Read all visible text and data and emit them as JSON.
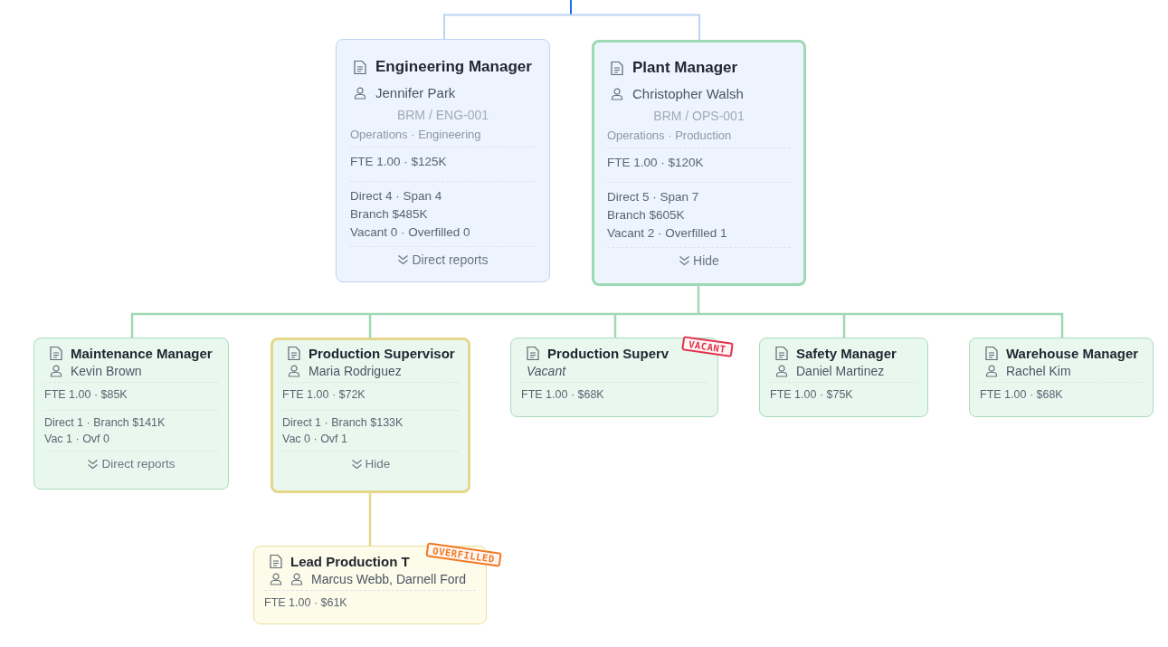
{
  "nodes": [
    {
      "title": "Engineering Manager",
      "color": "#eef4fe",
      "highlighted": false,
      "person": {
        "text": "Jennifer Park",
        "vacant": false
      },
      "code": "BRM / ENG-001",
      "department": "Operations · Engineering",
      "sections": [
        [
          "FTE 1.00 · $125K"
        ],
        [
          "Direct 4 · Span 4",
          "Branch $485K",
          "Vacant 0 · Overfilled 0"
        ]
      ],
      "toggle": "Direct reports"
    },
    {
      "title": "Plant Manager",
      "color": "#eef4fe",
      "highlighted": true,
      "person": {
        "text": "Christopher Walsh",
        "vacant": false
      },
      "code": "BRM / OPS-001",
      "department": "Operations · Production",
      "sections": [
        [
          "FTE 1.00 · $120K"
        ],
        [
          "Direct 5 · Span 7",
          "Branch $605K",
          "Vacant 2 · Overfilled 1"
        ]
      ],
      "toggle": "Hide"
    },
    {
      "title": "Maintenance Manager",
      "color": "#e9f8ef",
      "highlighted": false,
      "person": {
        "text": "Kevin Brown",
        "vacant": false
      },
      "sections": [
        [
          "FTE 1.00 · $85K"
        ],
        [
          "Direct 1 · Branch $141K",
          "Vac 1 · Ovf 0"
        ]
      ],
      "toggle": "Direct reports"
    },
    {
      "title": "Production Supervisor",
      "color": "#e9f8ef",
      "highlighted": true,
      "person": {
        "text": "Maria Rodriguez",
        "vacant": false
      },
      "sections": [
        [
          "FTE 1.00 · $72K"
        ],
        [
          "Direct 1 · Branch $133K",
          "Vac 0 · Ovf 1"
        ]
      ],
      "toggle": "Hide"
    },
    {
      "title": "Production Superv",
      "color": "#e9f8ef",
      "highlighted": false,
      "person": {
        "text": "Vacant",
        "vacant": true
      },
      "sections": [
        [
          "FTE 1.00 · $68K"
        ]
      ],
      "stamp": {
        "label": "VACANT",
        "color": "#e0334f"
      }
    },
    {
      "title": "Safety Manager",
      "color": "#e9f8ef",
      "highlighted": false,
      "person": {
        "text": "Daniel Martinez",
        "vacant": false
      },
      "sections": [
        [
          "FTE 1.00 · $75K"
        ]
      ]
    },
    {
      "title": "Warehouse Manager",
      "color": "#e9f8ef",
      "highlighted": false,
      "person": {
        "text": "Rachel Kim",
        "vacant": false
      },
      "sections": [
        [
          "FTE 1.00 · $68K"
        ]
      ]
    },
    {
      "title": "Lead Production T",
      "color": "#fdfbe9",
      "highlighted": false,
      "person": {
        "text": "Marcus Webb, Darnell Ford",
        "vacant": false,
        "group": true
      },
      "sections": [
        [
          "FTE 1.00 · $61K"
        ]
      ],
      "stamp": {
        "label": "OVERFILLED",
        "color": "#f07a22"
      }
    }
  ]
}
